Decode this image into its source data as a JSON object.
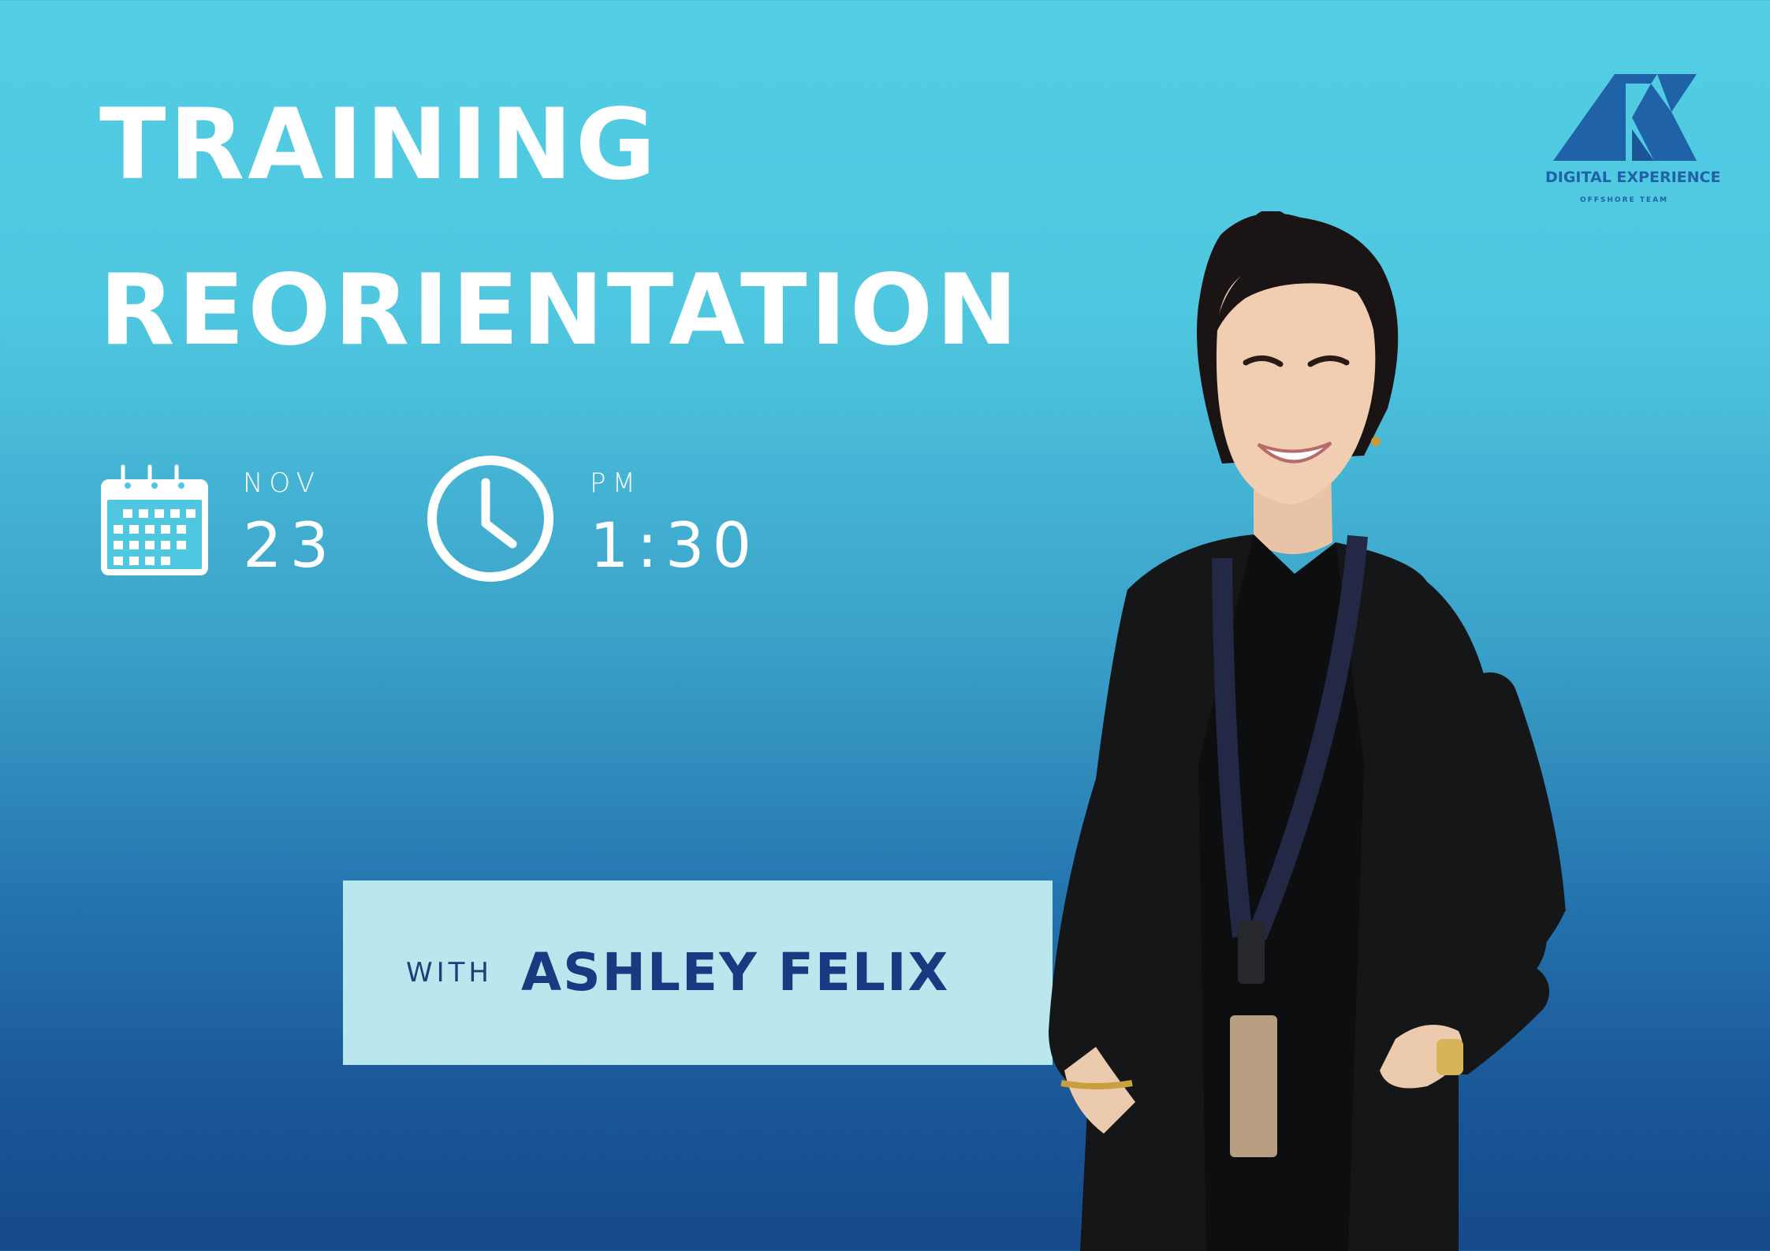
{
  "event": {
    "title_line_1": "TRAINING",
    "title_line_2": "REORIENTATION",
    "date": {
      "month": "NOV",
      "day": "23"
    },
    "time": {
      "period": "PM",
      "clock": "1:30"
    }
  },
  "presenter": {
    "prefix": "WITH",
    "name": "ASHLEY FELIX"
  },
  "brand": {
    "name": "DIGITAL EXPERIENCE",
    "tagline": "OFFSHORE TEAM"
  },
  "icons": {
    "calendar": "calendar-icon",
    "clock": "clock-icon",
    "logo": "dx-logo-icon"
  },
  "colors": {
    "background_top": "#52cde3",
    "background_bottom": "#164a8a",
    "title_text": "#ffffff",
    "banner_bg": "#bae6ee",
    "presenter_text": "#173a80",
    "logo_blue": "#1f62a8"
  }
}
